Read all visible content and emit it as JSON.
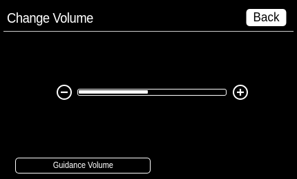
{
  "screen": {
    "title": "Change Volume",
    "back_label": "Back"
  },
  "volume": {
    "level_fraction": 0.47,
    "decrease_icon": "minus-circle-icon",
    "increase_icon": "plus-circle-icon"
  },
  "footer": {
    "guidance_label": "Guidance Volume"
  },
  "colors": {
    "background": "#000000",
    "foreground": "#ffffff",
    "button_fill": "#ffffff",
    "button_text": "#000000"
  }
}
